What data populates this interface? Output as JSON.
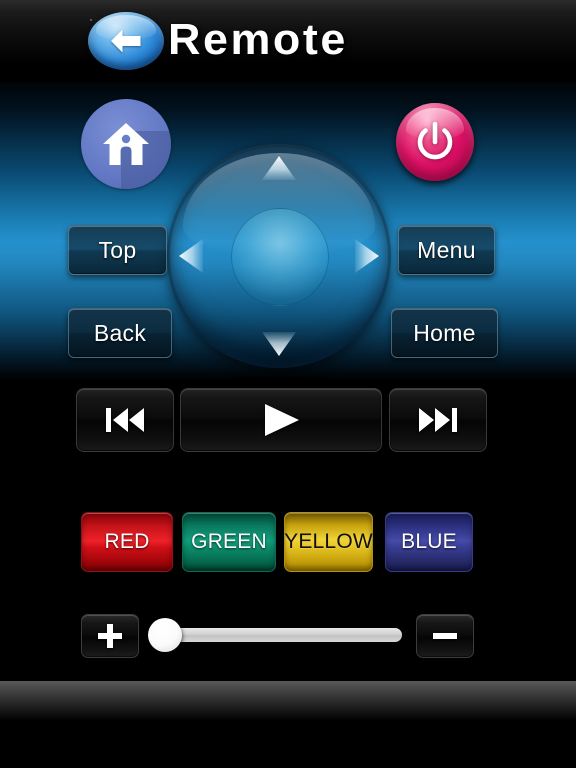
{
  "header": {
    "title": "Remote",
    "back_icon": "back-arrow-icon"
  },
  "panel": {
    "home_icon": "home-house-icon",
    "power_icon": "power-icon",
    "dpad": {
      "up_icon": "arrow-up-icon",
      "down_icon": "arrow-down-icon",
      "left_icon": "arrow-left-icon",
      "right_icon": "arrow-right-icon",
      "ok_label": ""
    },
    "buttons": {
      "top": "Top",
      "back": "Back",
      "menu": "Menu",
      "home": "Home"
    }
  },
  "media": {
    "previous_icon": "skip-previous-icon",
    "play_icon": "play-icon",
    "next_icon": "skip-next-icon"
  },
  "colors": {
    "red": "RED",
    "green": "GREEN",
    "yellow": "YELLOW",
    "blue": "BLUE",
    "red_hex": "#ef2129",
    "green_hex": "#11a07c",
    "yellow_hex": "#f2d338",
    "blue_hex": "#454ba8"
  },
  "volume": {
    "plus_icon": "plus-icon",
    "minus_icon": "minus-icon",
    "value": 0,
    "min": 0,
    "max": 100
  },
  "theme": {
    "background": "#000000",
    "panel_accent": "#2590cc",
    "back_button": "#2e89d8",
    "power_button": "#dd1166",
    "home_button": "#6a7fca"
  }
}
